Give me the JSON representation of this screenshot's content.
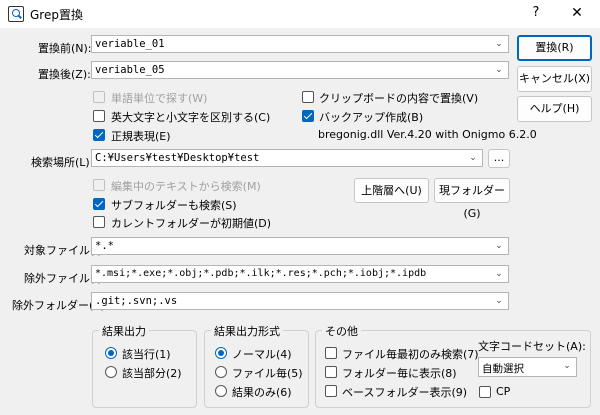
{
  "window": {
    "title": "Grep置換",
    "help_glyph": "?",
    "close_glyph": "✕"
  },
  "fields": {
    "replace_before_label": "置換前(N):",
    "replace_before_value": "veriable_01",
    "replace_after_label": "置換後(Z):",
    "replace_after_value": "veriable_05",
    "search_location_label": "検索場所(L):",
    "search_location_value": "C:¥Users¥test¥Desktop¥test",
    "target_files_label": "対象ファイル(I):",
    "target_files_value": "*.*",
    "exclude_files_label": "除外ファイル(I):",
    "exclude_files_value": "*.msi;*.exe;*.obj;*.pdb;*.ilk;*.res;*.pch;*.iobj;*.ipdb",
    "exclude_folders_label": "除外フォルダー(K):",
    "exclude_folders_value": ".git;.svn;.vs"
  },
  "options": {
    "word_unit": "単語単位で探す(W)",
    "case_sensitive": "英大文字と小文字を区別する(C)",
    "regex": "正規表現(E)",
    "clipboard_replace": "クリップボードの内容で置換(V)",
    "backup": "バックアップ作成(B)",
    "regex_lib_info": "bregonig.dll Ver.4.20 with Onigmo 6.2.0",
    "search_from_editing": "編集中のテキストから検索(M)",
    "search_subfolders": "サブフォルダーも検索(S)",
    "current_folder_default": "カレントフォルダーが初期値(D)"
  },
  "buttons": {
    "replace": "置換(R)",
    "cancel": "キャンセル(X)",
    "help": "ヘルプ(H)",
    "browse": "...",
    "parent_dir": "上階層へ(U)",
    "current_folder": "現フォルダー(G)"
  },
  "result_output": {
    "title": "結果出力",
    "matching_line": "該当行(1)",
    "matching_part": "該当部分(2)"
  },
  "output_format": {
    "title": "結果出力形式",
    "normal": "ノーマル(4)",
    "per_file": "ファイル毎(5)",
    "result_only": "結果のみ(6)"
  },
  "other": {
    "title": "その他",
    "first_only_per_file": "ファイル毎最初のみ検索(7)",
    "show_per_folder": "フォルダー毎に表示(8)",
    "show_base_folder": "ベースフォルダー表示(9)",
    "charset_label": "文字コードセット(A):",
    "charset_value": "自動選択",
    "cp_label": "CP"
  }
}
